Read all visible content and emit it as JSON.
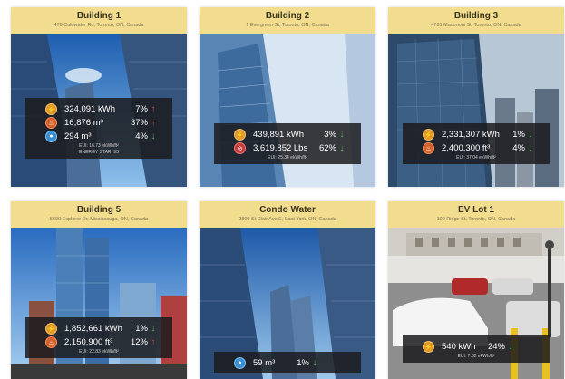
{
  "cards": [
    {
      "title": "Building 1",
      "address": "478 Caldwater Rd, Toronto, ON, Canada",
      "metrics": [
        {
          "icon": "electricity-icon",
          "value": "324,091 kWh",
          "pct": "7%",
          "trend": "up"
        },
        {
          "icon": "gas-icon",
          "value": "16,876 m³",
          "pct": "37%",
          "trend": "up"
        },
        {
          "icon": "water-icon",
          "value": "294 m³",
          "pct": "4%",
          "trend": "down"
        }
      ],
      "eui": "EUI: 16.73 ekWh/ft²",
      "energy_star": "ENERGY STAR: 95"
    },
    {
      "title": "Building 2",
      "address": "1 Evergreen St, Toronto, ON, Canada",
      "metrics": [
        {
          "icon": "electricity-icon",
          "value": "439,891 kWh",
          "pct": "3%",
          "trend": "down"
        },
        {
          "icon": "co2-icon",
          "value": "3,619,852 Lbs",
          "pct": "62%",
          "trend": "down"
        }
      ],
      "eui": "EUI: 25.34 ekWh/ft²"
    },
    {
      "title": "Building 3",
      "address": "4701 Macononi St, Toronto, ON, Canada",
      "metrics": [
        {
          "icon": "electricity-icon",
          "value": "2,331,307 kWh",
          "pct": "1%",
          "trend": "down"
        },
        {
          "icon": "gas-icon",
          "value": "2,400,300 ft³",
          "pct": "4%",
          "trend": "down"
        }
      ],
      "eui": "EUI: 37.04 ekWh/ft²"
    },
    {
      "title": "Building 5",
      "address": "5600 Explorer Dr, Mississauga, ON, Canada",
      "metrics": [
        {
          "icon": "electricity-icon",
          "value": "1,852,661 kWh",
          "pct": "1%",
          "trend": "down"
        },
        {
          "icon": "gas-icon",
          "value": "2,150,900 ft³",
          "pct": "12%",
          "trend": "up"
        }
      ],
      "eui": "EUI: 22.83 ekWh/ft²"
    },
    {
      "title": "Condo Water",
      "address": "2800 St Clair Ave E, East York, ON, Canada",
      "metrics": [
        {
          "icon": "water-icon",
          "value": "59 m³",
          "pct": "1%",
          "trend": "down"
        }
      ],
      "eui": ""
    },
    {
      "title": "EV Lot 1",
      "address": "100 Ridge St, Toronto, ON, Canada",
      "metrics": [
        {
          "icon": "electricity-icon",
          "value": "540 kWh",
          "pct": "24%",
          "trend": "down"
        }
      ],
      "eui": "EUI: 7.82 ekWh/ft²"
    }
  ],
  "icon_glyphs": {
    "electricity-icon": "⚡",
    "gas-icon": "♨",
    "water-icon": "●",
    "co2-icon": "⊘"
  },
  "trend_glyphs": {
    "up": "↑",
    "down": "↓"
  }
}
